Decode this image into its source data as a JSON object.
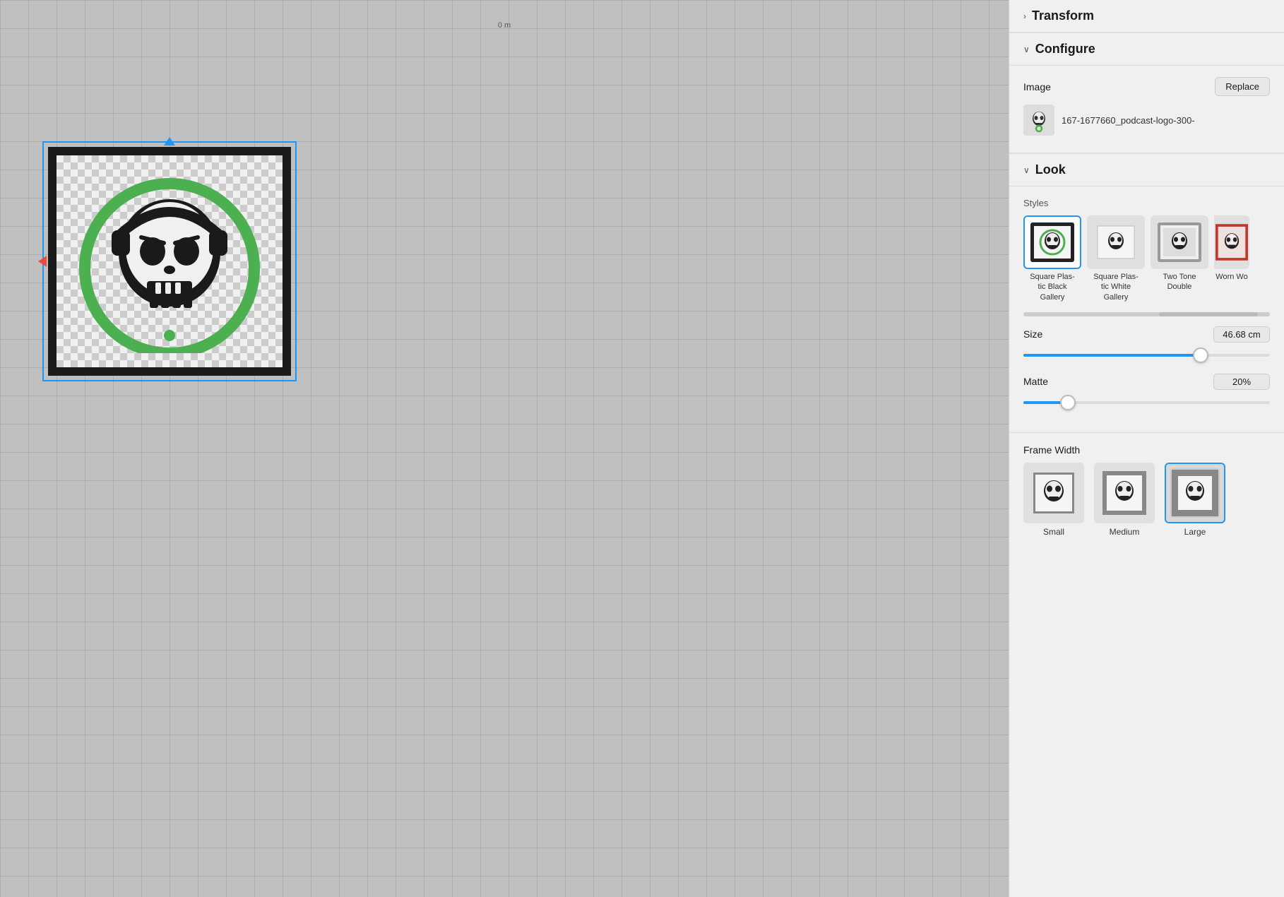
{
  "panel": {
    "sections": {
      "transform": {
        "title": "Transform",
        "collapsed": true
      },
      "configure": {
        "title": "Configure",
        "image_label": "Image",
        "replace_label": "Replace",
        "filename": "167-1677660_podcast-logo-300-"
      },
      "look": {
        "title": "Look",
        "styles_label": "Styles",
        "styles": [
          {
            "id": "square-black",
            "label": "Square Plas-\ntic Black\nGallery",
            "selected": true
          },
          {
            "id": "square-white",
            "label": "Square Plas-\ntic White\nGallery",
            "selected": false
          },
          {
            "id": "two-tone",
            "label": "Two Tone\nDouble",
            "selected": false
          },
          {
            "id": "worn-wo",
            "label": "Worn Wo",
            "selected": false,
            "partial": true
          }
        ],
        "size_label": "Size",
        "size_value": "46.68 cm",
        "size_percent": 72,
        "matte_label": "Matte",
        "matte_value": "20%",
        "matte_percent": 18,
        "frame_width_label": "Frame Width",
        "frame_widths": [
          {
            "id": "small",
            "label": "Small",
            "selected": false
          },
          {
            "id": "medium",
            "label": "Medium",
            "selected": false
          },
          {
            "id": "large",
            "label": "Large",
            "selected": true
          }
        ]
      }
    }
  },
  "canvas": {
    "ruler_label": "0 m"
  }
}
